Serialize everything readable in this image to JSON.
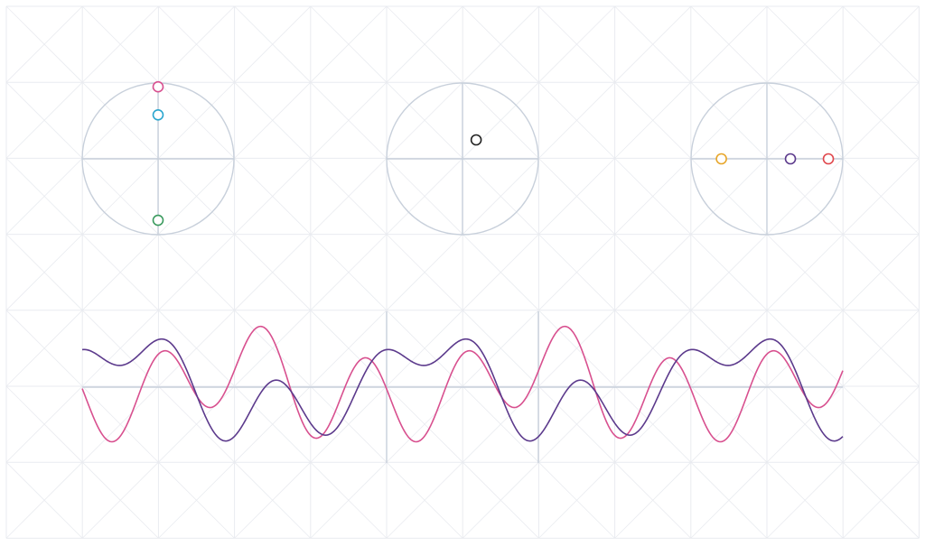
{
  "colors": {
    "background": "#ffffff",
    "grid": "#e9ebf0",
    "axes": "#c8d0db",
    "curve_a": "#d8508f",
    "curve_b": "#5c3a8c"
  },
  "circles": [
    {
      "name": "left-unit-circle",
      "points": [
        {
          "name": "pink-point",
          "color": "#d8508f",
          "x": 0,
          "y": 0.95
        },
        {
          "name": "cyan-point",
          "color": "#2aa6cf",
          "y": 0.58,
          "x": 0
        },
        {
          "name": "green-point",
          "color": "#3a9a5e",
          "x": 0,
          "y": -0.81
        }
      ]
    },
    {
      "name": "center-unit-circle",
      "points": [
        {
          "name": "black-point",
          "color": "#222222",
          "x": 0.18,
          "y": 0.25
        }
      ]
    },
    {
      "name": "right-unit-circle",
      "points": [
        {
          "name": "orange-point",
          "color": "#e7a62a",
          "x": -0.6,
          "y": 0
        },
        {
          "name": "purple-point",
          "color": "#5c3a8c",
          "x": 0.31,
          "y": 0
        },
        {
          "name": "red-point",
          "color": "#e0474c",
          "x": 0.81,
          "y": 0
        }
      ]
    }
  ],
  "waveform": {
    "periods": 2.5,
    "series": [
      {
        "color": "#d8508f",
        "harmonics": [
          [
            1,
            0.25,
            -1.5708
          ],
          [
            2,
            0.1,
            1.5708
          ],
          [
            3,
            0.55,
            2.9
          ]
        ]
      },
      {
        "color": "#5c3a8c",
        "harmonics": [
          [
            1,
            0.45,
            0.7
          ],
          [
            2,
            0.2,
            -0.4
          ],
          [
            3,
            0.35,
            2.2
          ]
        ]
      }
    ]
  }
}
